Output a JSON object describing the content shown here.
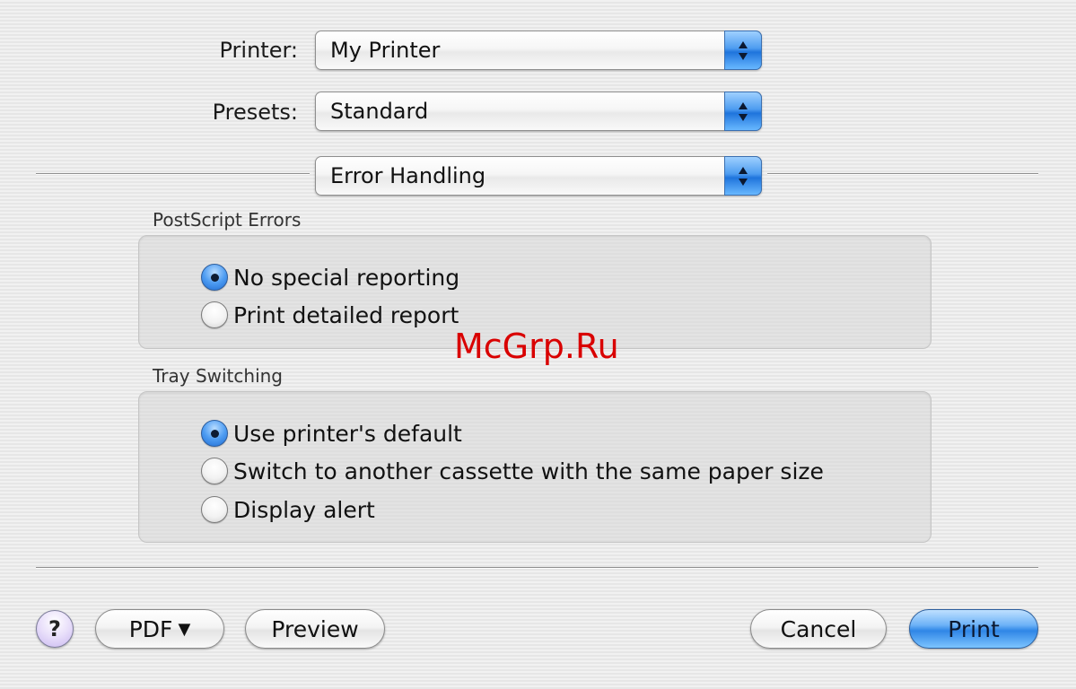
{
  "form": {
    "printer": {
      "label": "Printer:",
      "value": "My Printer"
    },
    "presets": {
      "label": "Presets:",
      "value": "Standard"
    },
    "pane": {
      "value": "Error Handling"
    }
  },
  "postscript_errors": {
    "title": "PostScript Errors",
    "options": [
      {
        "label": "No special reporting",
        "selected": true
      },
      {
        "label": "Print detailed report",
        "selected": false
      }
    ]
  },
  "tray_switching": {
    "title": "Tray Switching",
    "options": [
      {
        "label": "Use printer's default",
        "selected": true
      },
      {
        "label": "Switch to another cassette with the same paper size",
        "selected": false
      },
      {
        "label": "Display alert",
        "selected": false
      }
    ]
  },
  "buttons": {
    "help": "?",
    "pdf": "PDF",
    "pdf_caret": "▼",
    "preview": "Preview",
    "cancel": "Cancel",
    "print": "Print"
  },
  "watermark": "McGrp.Ru",
  "colors": {
    "accent": "#2f86e6",
    "watermark": "#d90000"
  }
}
